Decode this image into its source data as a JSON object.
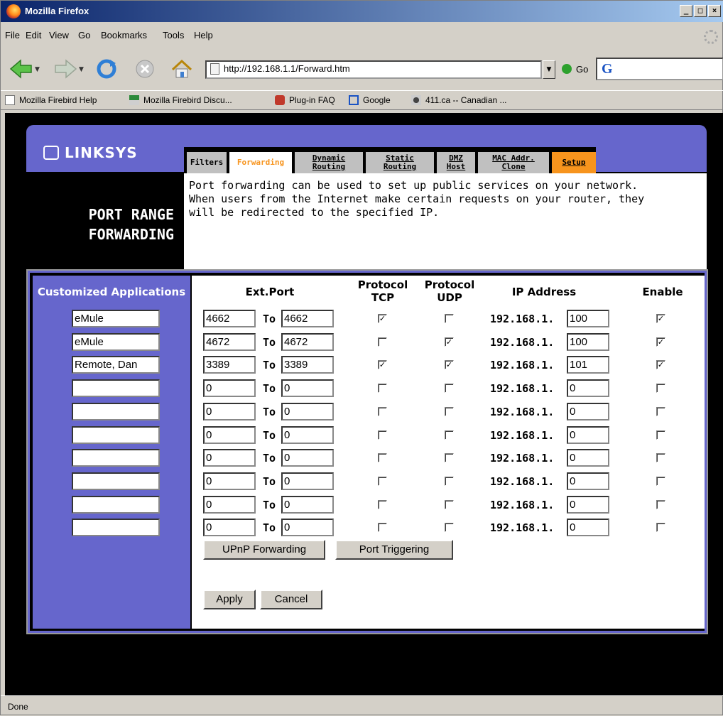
{
  "window": {
    "title": "Mozilla Firefox"
  },
  "menu": [
    "File",
    "Edit",
    "View",
    "Go",
    "Bookmarks",
    "Tools",
    "Help"
  ],
  "url": "http://192.168.1.1/Forward.htm",
  "go_label": "Go",
  "google_glyph": "G",
  "bookmarks": [
    {
      "label": "Mozilla Firebird Help",
      "icon": "page-icon"
    },
    {
      "label": "Mozilla Firebird Discu...",
      "icon": "zine-icon"
    },
    {
      "label": "Plug-in FAQ",
      "icon": "plugin-icon"
    },
    {
      "label": "Google",
      "icon": "google-icon"
    },
    {
      "label": "411.ca -- Canadian ...",
      "icon": "411-icon"
    }
  ],
  "status": "Done",
  "router": {
    "brand": "LINKSYS",
    "tabs": [
      {
        "label": "Filters",
        "active": false
      },
      {
        "label": "Forwarding",
        "active": true
      },
      {
        "label": "Dynamic Routing",
        "active": false
      },
      {
        "label": "Static Routing",
        "active": false
      },
      {
        "label": "DMZ Host",
        "active": false
      },
      {
        "label": "MAC Addr. Clone",
        "active": false
      },
      {
        "label": "Setup",
        "active": false
      }
    ],
    "page_title_line1": "PORT RANGE",
    "page_title_line2": "FORWARDING",
    "description": "Port forwarding can be used to set up public services on your network.\nWhen users from the Internet make certain requests on your router, they\nwill be redirected to the specified IP.",
    "headers": {
      "apps": "Customized Applications",
      "ext_port": "Ext.Port",
      "tcp_line1": "Protocol",
      "tcp_line2": "TCP",
      "udp_line1": "Protocol",
      "udp_line2": "UDP",
      "ip": "IP Address",
      "enable": "Enable"
    },
    "to_label": "To",
    "ip_prefix": "192.168.1.",
    "rows": [
      {
        "app": "eMule",
        "from": "4662",
        "to": "4662",
        "tcp": true,
        "udp": false,
        "ip": "100",
        "enable": true
      },
      {
        "app": "eMule",
        "from": "4672",
        "to": "4672",
        "tcp": false,
        "udp": true,
        "ip": "100",
        "enable": true
      },
      {
        "app": "Remote, Dan",
        "from": "3389",
        "to": "3389",
        "tcp": true,
        "udp": true,
        "ip": "101",
        "enable": true
      },
      {
        "app": "",
        "from": "0",
        "to": "0",
        "tcp": false,
        "udp": false,
        "ip": "0",
        "enable": false
      },
      {
        "app": "",
        "from": "0",
        "to": "0",
        "tcp": false,
        "udp": false,
        "ip": "0",
        "enable": false
      },
      {
        "app": "",
        "from": "0",
        "to": "0",
        "tcp": false,
        "udp": false,
        "ip": "0",
        "enable": false
      },
      {
        "app": "",
        "from": "0",
        "to": "0",
        "tcp": false,
        "udp": false,
        "ip": "0",
        "enable": false
      },
      {
        "app": "",
        "from": "0",
        "to": "0",
        "tcp": false,
        "udp": false,
        "ip": "0",
        "enable": false
      },
      {
        "app": "",
        "from": "0",
        "to": "0",
        "tcp": false,
        "udp": false,
        "ip": "0",
        "enable": false
      },
      {
        "app": "",
        "from": "0",
        "to": "0",
        "tcp": false,
        "udp": false,
        "ip": "0",
        "enable": false
      }
    ],
    "buttons": {
      "upnp": "UPnP Forwarding",
      "trigger": "Port Triggering",
      "apply": "Apply",
      "cancel": "Cancel"
    }
  }
}
